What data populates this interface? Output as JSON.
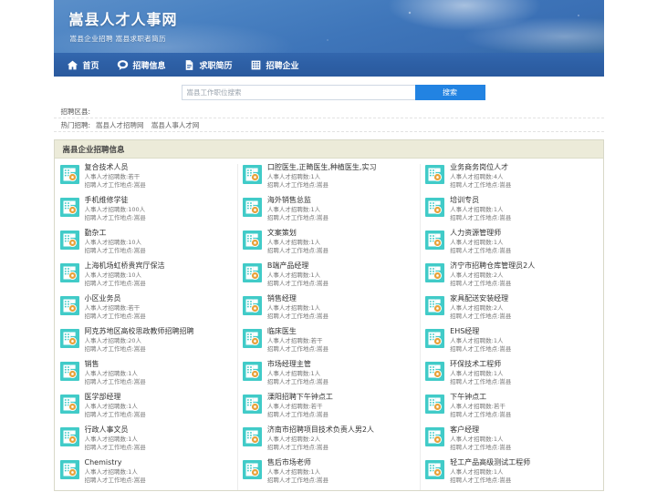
{
  "site": {
    "title": "嵩县人才人事网",
    "subtitle": "嵩县企业招聘 嵩县求职者简历"
  },
  "nav": {
    "items": [
      {
        "label": "首页",
        "icon": "home-icon"
      },
      {
        "label": "招聘信息",
        "icon": "chat-bubble-icon"
      },
      {
        "label": "求职简历",
        "icon": "document-icon"
      },
      {
        "label": "招聘企业",
        "icon": "building-icon"
      }
    ]
  },
  "search": {
    "placeholder": "嵩县工作职位搜索",
    "value": "",
    "button_label": "搜索"
  },
  "filters": [
    {
      "label": "招聘区县:",
      "links": []
    },
    {
      "label": "热门招聘:",
      "links": [
        "嵩县人才招聘网",
        "嵩县人事人才网"
      ]
    }
  ],
  "panel": {
    "title": "嵩县企业招聘信息",
    "meta_count_prefix": "人事人才招聘数:",
    "meta_place_prefix": "招聘人才工作地点:",
    "columns": [
      {
        "jobs": [
          {
            "title": "复合技术人员",
            "count": "若干",
            "place": "嵩县"
          },
          {
            "title": "手机维修学徒",
            "count": "100人",
            "place": "嵩县"
          },
          {
            "title": "勤杂工",
            "count": "10人",
            "place": "嵩县"
          },
          {
            "title": "上海机场虹桥贵宾厅保洁",
            "count": "10人",
            "place": "嵩县"
          },
          {
            "title": "小区业务员",
            "count": "若干",
            "place": "嵩县"
          },
          {
            "title": "阿克苏地区高校思政教师招聘招聘",
            "count": "20人",
            "place": "嵩县"
          },
          {
            "title": "销售",
            "count": "1人",
            "place": "嵩县"
          },
          {
            "title": "医学部经理",
            "count": "1人",
            "place": "嵩县"
          },
          {
            "title": "行政人事文员",
            "count": "1人",
            "place": "嵩县"
          },
          {
            "title": "Chemistry",
            "count": "1人",
            "place": "嵩县"
          }
        ]
      },
      {
        "jobs": [
          {
            "title": "口腔医生,正畸医生,种植医生,实习",
            "count": "1人",
            "place": "嵩县"
          },
          {
            "title": "海外销售总监",
            "count": "1人",
            "place": "嵩县"
          },
          {
            "title": "文案策划",
            "count": "1人",
            "place": "嵩县"
          },
          {
            "title": "B端产品经理",
            "count": "1人",
            "place": "嵩县"
          },
          {
            "title": "销售经理",
            "count": "1人",
            "place": "嵩县"
          },
          {
            "title": "临床医生",
            "count": "若干",
            "place": "嵩县"
          },
          {
            "title": "市场经理主管",
            "count": "1人",
            "place": "嵩县"
          },
          {
            "title": "溧阳招聘下午钟点工",
            "count": "若干",
            "place": "嵩县"
          },
          {
            "title": "济南市招聘项目技术负责人男2人",
            "count": "2人",
            "place": "嵩县"
          },
          {
            "title": "售后市场老师",
            "count": "1人",
            "place": "嵩县"
          }
        ]
      },
      {
        "jobs": [
          {
            "title": "业务商务岗位人才",
            "count": "4人",
            "place": "嵩县"
          },
          {
            "title": "培训专员",
            "count": "1人",
            "place": "嵩县"
          },
          {
            "title": "人力资源管理师",
            "count": "1人",
            "place": "嵩县"
          },
          {
            "title": "济宁市招聘仓库管理员2人",
            "count": "2人",
            "place": "嵩县"
          },
          {
            "title": "家具配送安装经理",
            "count": "2人",
            "place": "嵩县"
          },
          {
            "title": "EHS经理",
            "count": "1人",
            "place": "嵩县"
          },
          {
            "title": "环保技术工程师",
            "count": "1人",
            "place": "嵩县"
          },
          {
            "title": "下午钟点工",
            "count": "若干",
            "place": "嵩县"
          },
          {
            "title": "客户经理",
            "count": "1人",
            "place": "嵩县"
          },
          {
            "title": "轻工产品高级测试工程师",
            "count": "1人",
            "place": "嵩县"
          }
        ]
      }
    ]
  },
  "colors": {
    "nav_blue": "#2d5fa5",
    "banner_blue": "#3f76ba",
    "search_button": "#2283e2",
    "panel_head": "#ecebd9",
    "job_icon_teal": "#41cbc8",
    "job_icon_accent": "#e8a33d"
  }
}
